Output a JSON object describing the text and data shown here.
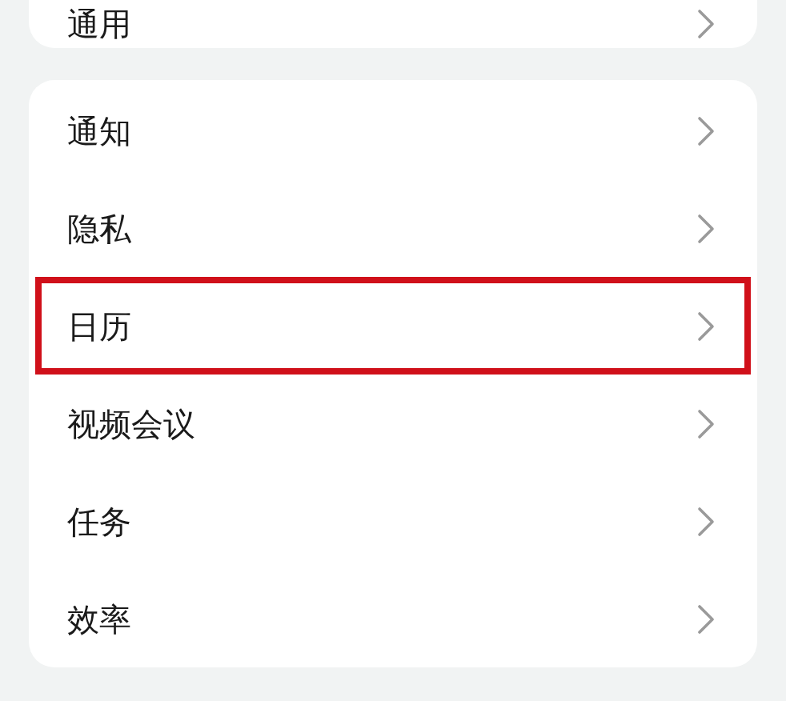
{
  "groups": [
    {
      "items": [
        {
          "label": "通用",
          "highlighted": false
        }
      ]
    },
    {
      "items": [
        {
          "label": "通知",
          "highlighted": false
        },
        {
          "label": "隐私",
          "highlighted": false
        },
        {
          "label": "日历",
          "highlighted": true
        },
        {
          "label": "视频会议",
          "highlighted": false
        },
        {
          "label": "任务",
          "highlighted": false
        },
        {
          "label": "效率",
          "highlighted": false
        }
      ]
    }
  ]
}
